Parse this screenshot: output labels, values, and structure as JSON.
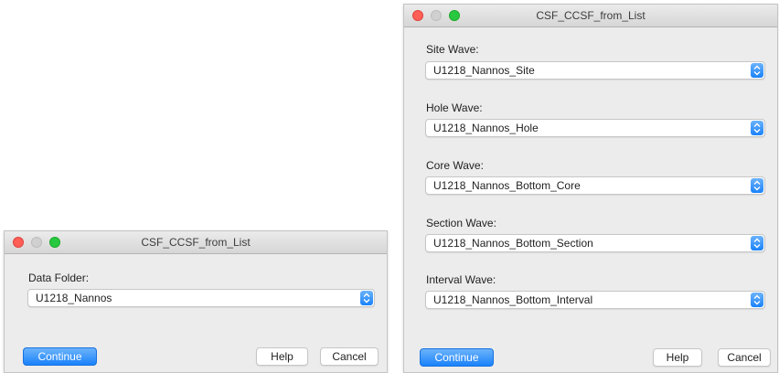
{
  "small_dialog": {
    "title": "CSF_CCSF_from_List",
    "data_folder_label": "Data Folder:",
    "data_folder_value": "U1218_Nannos",
    "continue_label": "Continue",
    "help_label": "Help",
    "cancel_label": "Cancel"
  },
  "large_dialog": {
    "title": "CSF_CCSF_from_List",
    "fields": [
      {
        "label": "Site Wave:",
        "value": "U1218_Nannos_Site"
      },
      {
        "label": "Hole Wave:",
        "value": "U1218_Nannos_Hole"
      },
      {
        "label": "Core Wave:",
        "value": "U1218_Nannos_Bottom_Core"
      },
      {
        "label": "Section Wave:",
        "value": "U1218_Nannos_Bottom_Section"
      },
      {
        "label": "Interval Wave:",
        "value": "U1218_Nannos_Bottom_Interval"
      }
    ],
    "continue_label": "Continue",
    "help_label": "Help",
    "cancel_label": "Cancel"
  },
  "colors": {
    "accent": "#1a82fb",
    "window_bg": "#ececec",
    "close": "#ff5f57",
    "maximize": "#28c840"
  },
  "icons": {
    "popup_arrows": "chevron-up-down-icon"
  }
}
